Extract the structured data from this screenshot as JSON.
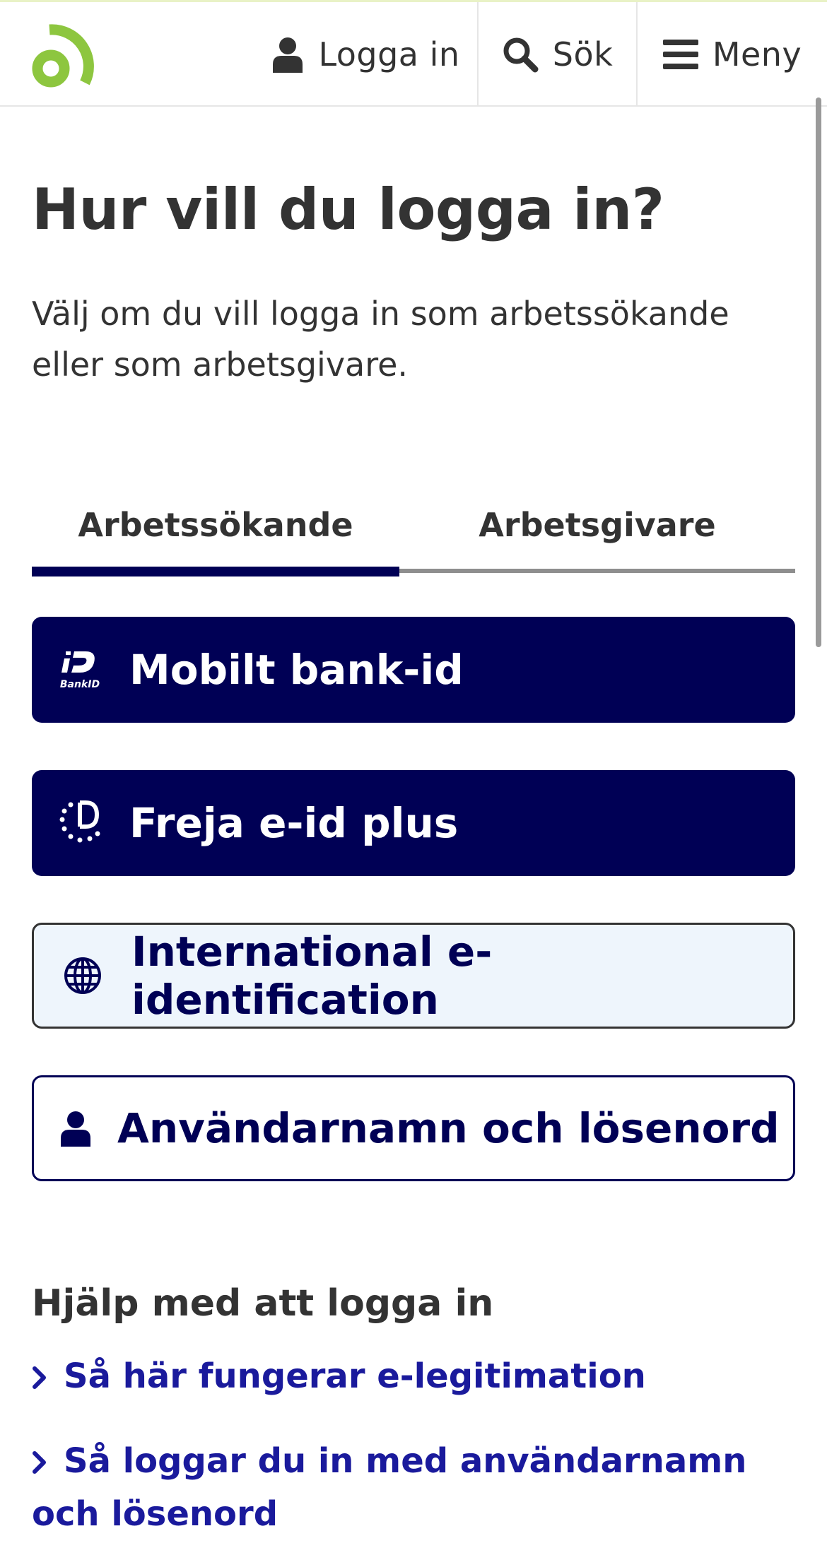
{
  "header": {
    "logo_icon": "arbetsformedlingen-logo-icon",
    "login_label": "Logga in",
    "search_label": "Sök",
    "menu_label": "Meny"
  },
  "page": {
    "title": "Hur vill du logga in?",
    "intro": "Välj om du vill logga in som arbetssökande eller som arbetsgivare."
  },
  "tabs": [
    {
      "label": "Arbetssökande",
      "active": true
    },
    {
      "label": "Arbetsgivare",
      "active": false
    }
  ],
  "login_options": [
    {
      "label": "Mobilt bank-id",
      "icon": "bankid-icon"
    },
    {
      "label": "Freja e-id plus",
      "icon": "freja-icon"
    },
    {
      "label": "International e-identification",
      "icon": "globe-icon"
    },
    {
      "label": "Användarnamn och lösenord",
      "icon": "user-icon"
    }
  ],
  "bankid_icon_text": "BankID",
  "help": {
    "heading": "Hjälp med att logga in",
    "links": [
      {
        "label": "Så här fungerar e-legitimation"
      },
      {
        "label": "Så loggar du in med användarnamn och lösenord"
      }
    ]
  },
  "colors": {
    "primary": "#000055",
    "link": "#1a1a9c",
    "logo_green": "#8dc63f",
    "text": "#333333",
    "intl_bg": "#eef5fc"
  }
}
